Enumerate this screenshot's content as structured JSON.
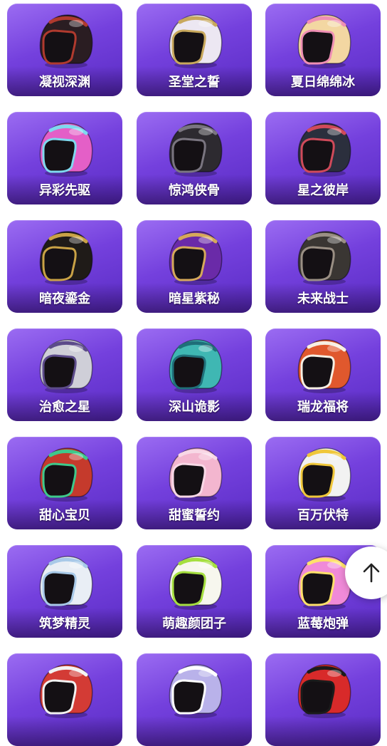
{
  "items": [
    {
      "name": "凝视深渊",
      "icon": "helmet-feathered-icon",
      "primary": "#2a1d22",
      "accent": "#b03a2e"
    },
    {
      "name": "圣堂之誓",
      "icon": "helmet-white-icon",
      "primary": "#ece7f2",
      "accent": "#c8a85c"
    },
    {
      "name": "夏日绵绵冰",
      "icon": "helmet-icecream-icon",
      "primary": "#f3d7a2",
      "accent": "#ef8fb4"
    },
    {
      "name": "异彩先驱",
      "icon": "helmet-pink-icon",
      "primary": "#e45fc7",
      "accent": "#7fd9ef"
    },
    {
      "name": "惊鸿侠骨",
      "icon": "helmet-black-icon",
      "primary": "#2d2a30",
      "accent": "#7a7580"
    },
    {
      "name": "星之彼岸",
      "icon": "helmet-dark-icon",
      "primary": "#2b2f3d",
      "accent": "#d04a5a"
    },
    {
      "name": "暗夜鎏金",
      "icon": "helmet-gold-black-icon",
      "primary": "#1f1b18",
      "accent": "#c9a246"
    },
    {
      "name": "暗星紫秘",
      "icon": "helmet-purple-gold-icon",
      "primary": "#6a2aa8",
      "accent": "#d6a95a"
    },
    {
      "name": "未来战士",
      "icon": "helmet-grey-icon",
      "primary": "#3a3633",
      "accent": "#9a8f84"
    },
    {
      "name": "治愈之星",
      "icon": "helmet-silver-icon",
      "primary": "#cfcfd8",
      "accent": "#5c4b8a"
    },
    {
      "name": "深山诡影",
      "icon": "helmet-teal-icon",
      "primary": "#3fb7b3",
      "accent": "#1f6f79"
    },
    {
      "name": "瑞龙福将",
      "icon": "helmet-orange-icon",
      "primary": "#e0582d",
      "accent": "#f6efe3"
    },
    {
      "name": "甜心宝贝",
      "icon": "helmet-red-visor-icon",
      "primary": "#c53a2c",
      "accent": "#3ec98b"
    },
    {
      "name": "甜蜜誓约",
      "icon": "helmet-pastel-pink-icon",
      "primary": "#f3b6cf",
      "accent": "#f8d8e6"
    },
    {
      "name": "百万伏特",
      "icon": "helmet-yellow-icon",
      "primary": "#f2f2f2",
      "accent": "#f0c73a"
    },
    {
      "name": "筑梦精灵",
      "icon": "helmet-light-icon",
      "primary": "#e9eef5",
      "accent": "#a8c9e8"
    },
    {
      "name": "萌趣颜团子",
      "icon": "helmet-cute-white-icon",
      "primary": "#f7f7ee",
      "accent": "#a5df3f"
    },
    {
      "name": "蓝莓炮弹",
      "icon": "helmet-pink-star-icon",
      "primary": "#f08ad8",
      "accent": "#ffe16a"
    },
    {
      "name": "",
      "icon": "helmet-red-icon",
      "primary": "#d33b35",
      "accent": "#f2f2f2"
    },
    {
      "name": "",
      "icon": "helmet-lavender-icon",
      "primary": "#b9b2ea",
      "accent": "#ffffff"
    },
    {
      "name": "",
      "icon": "helmet-red-cat-icon",
      "primary": "#d82a2a",
      "accent": "#1b1b1b"
    }
  ],
  "back_to_top": {
    "icon": "arrow-up-icon"
  }
}
